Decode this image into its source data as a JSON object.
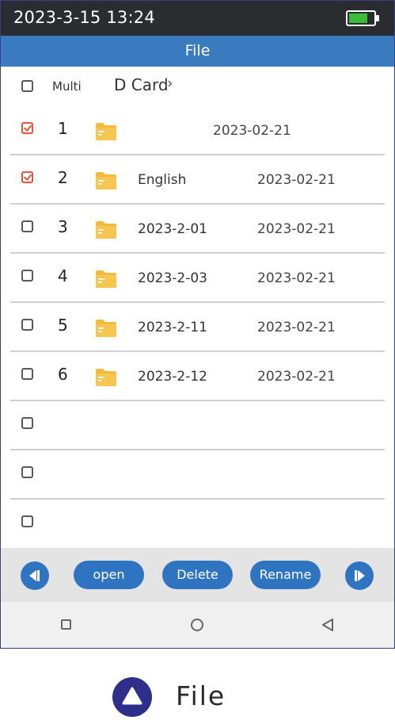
{
  "status_bar": {
    "time": "2023-3-15 13:24",
    "battery_level": 0.75,
    "battery_color": "#3cbc3c"
  },
  "title_bar": {
    "title": "File",
    "color": "#3a7abf"
  },
  "path_bar": {
    "multi_label": "Multi",
    "drive_label": "D Card",
    "chevron": "›"
  },
  "rows": [
    {
      "checked": true,
      "number": "1",
      "icon": "folder-icon",
      "name": "",
      "date": "2023-02-21"
    },
    {
      "checked": true,
      "number": "2",
      "icon": "folder-icon",
      "name": "English",
      "date": "2023-02-21"
    },
    {
      "checked": false,
      "number": "3",
      "icon": "folder-icon",
      "name": "2023-2-01",
      "date": "2023-02-21"
    },
    {
      "checked": false,
      "number": "4",
      "icon": "folder-icon",
      "name": "2023-2-03",
      "date": "2023-02-21"
    },
    {
      "checked": false,
      "number": "5",
      "icon": "folder-icon",
      "name": "2023-2-11",
      "date": "2023-02-21"
    },
    {
      "checked": false,
      "number": "6",
      "icon": "folder-icon",
      "name": "2023-2-12",
      "date": "2023-02-21"
    },
    {
      "checked": false,
      "number": "",
      "icon": "",
      "name": "",
      "date": ""
    },
    {
      "checked": false,
      "number": "",
      "icon": "",
      "name": "",
      "date": ""
    },
    {
      "checked": false,
      "number": "",
      "icon": "",
      "name": "",
      "date": ""
    }
  ],
  "toolbar": {
    "prev_icon": "skip-previous-icon",
    "open_label": "open",
    "delete_label": "Delete",
    "rename_label": "Rename",
    "next_icon": "skip-next-icon",
    "button_color": "#2f74c0"
  },
  "nav_bar": {
    "icons": [
      "recent-apps-icon",
      "home-icon",
      "back-icon"
    ]
  },
  "caption": {
    "icon": "triangle-up-icon",
    "text": "File"
  }
}
